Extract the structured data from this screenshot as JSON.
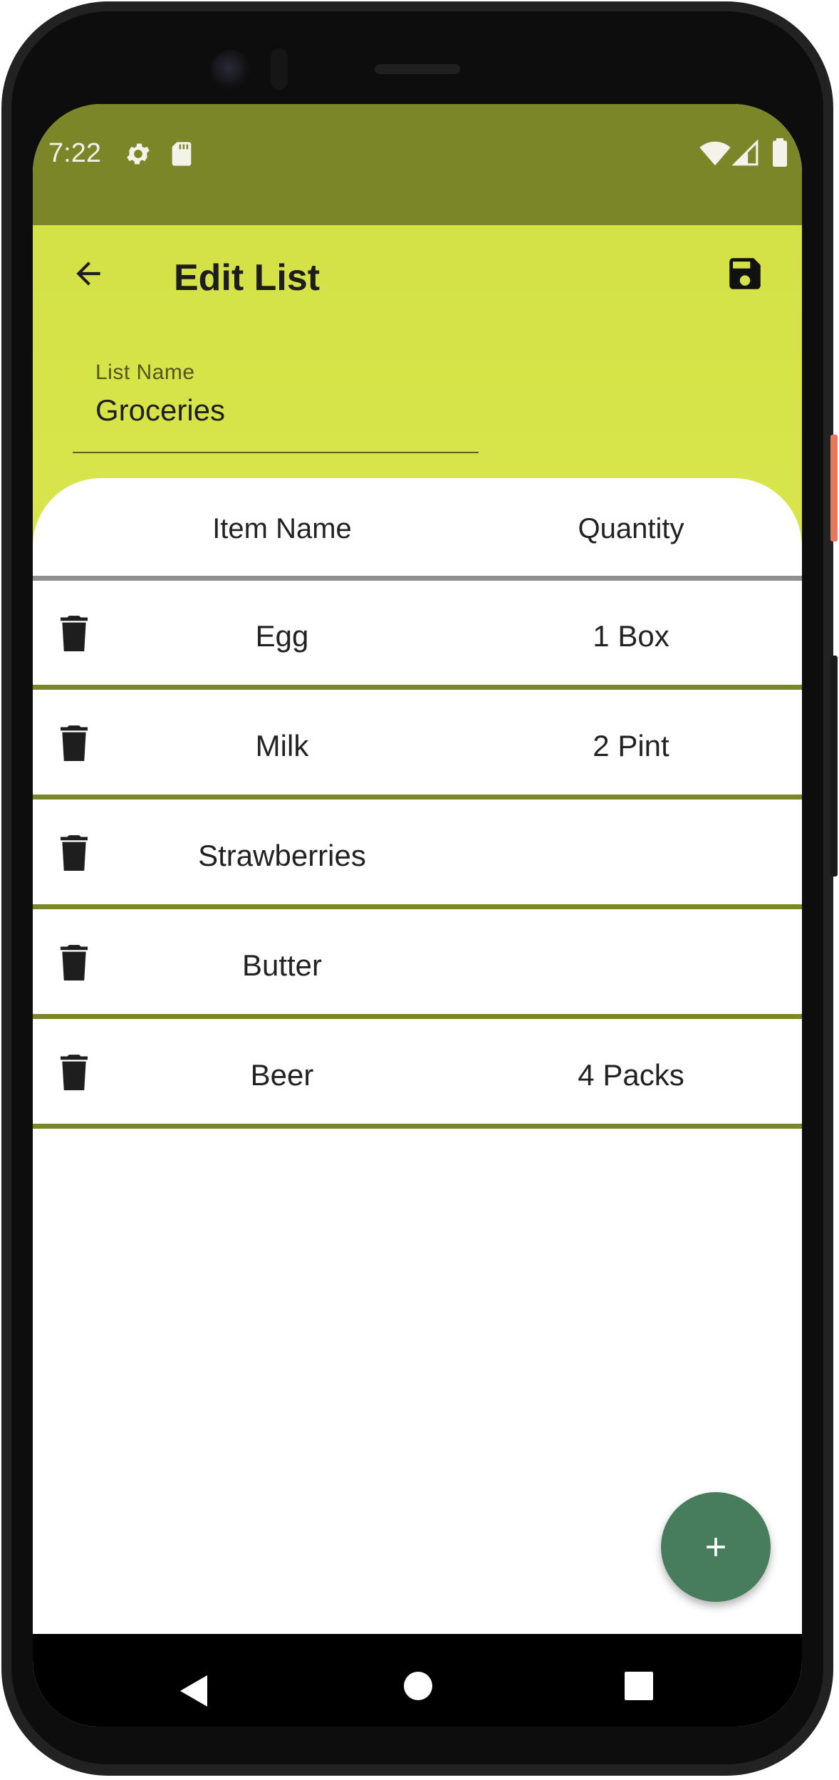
{
  "status_bar": {
    "time": "7:22",
    "icons": [
      "gear-icon",
      "sd-card-icon",
      "wifi-icon",
      "signal-icon",
      "battery-icon"
    ]
  },
  "app_bar": {
    "title": "Edit List",
    "back_icon": "arrow-back-icon",
    "save_icon": "floppy-disk-icon"
  },
  "list_name_field": {
    "label": "List Name",
    "value": "Groceries"
  },
  "table": {
    "headers": {
      "name": "Item Name",
      "quantity": "Quantity"
    },
    "rows": [
      {
        "name": "Egg",
        "quantity": "1 Box"
      },
      {
        "name": "Milk",
        "quantity": "2 Pint"
      },
      {
        "name": "Strawberries",
        "quantity": ""
      },
      {
        "name": "Butter",
        "quantity": ""
      },
      {
        "name": "Beer",
        "quantity": "4 Packs"
      }
    ],
    "delete_icon": "trash-icon"
  },
  "fab": {
    "icon": "plus-icon"
  },
  "nav_bar": {
    "icons": [
      "nav-back-icon",
      "nav-home-icon",
      "nav-recents-icon"
    ]
  },
  "colors": {
    "status_bar": "#7b8629",
    "app_bar": "#d7e449",
    "row_divider": "#7b8629",
    "header_divider": "#8f8f8f",
    "fab": "#477d5c"
  }
}
